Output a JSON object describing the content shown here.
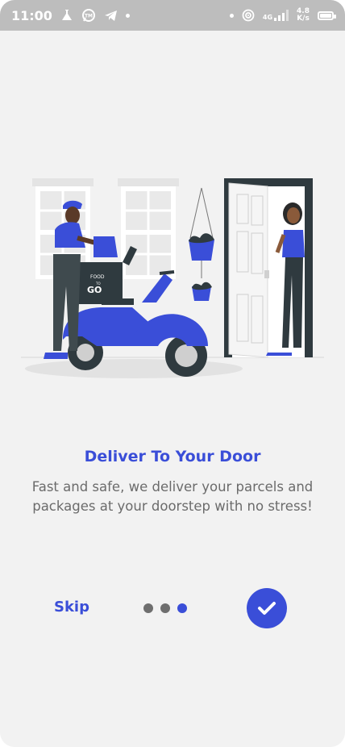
{
  "status_bar": {
    "time": "11:00",
    "network_speed_value": "4.8",
    "network_speed_unit": "K/s",
    "network_type": "4G",
    "icons": [
      "flask-icon",
      "tm-chat-icon",
      "telegram-icon",
      "hotspot-icon",
      "signal-icon",
      "battery-icon"
    ]
  },
  "onboarding": {
    "title": "Deliver To Your Door",
    "description": "Fast and safe, we deliver your parcels and packages at your doorstep with no stress!",
    "illustration_box_text": [
      "FOOD",
      "TO",
      "GO"
    ],
    "skip_label": "Skip",
    "page_count": 3,
    "current_page": 3,
    "done_icon": "check-icon"
  },
  "colors": {
    "accent": "#3a4ed8",
    "background": "#f2f2f2",
    "status_bar": "#bdbdbd",
    "text_muted": "#6b6b6b",
    "dot_inactive": "#6e6e6e"
  }
}
